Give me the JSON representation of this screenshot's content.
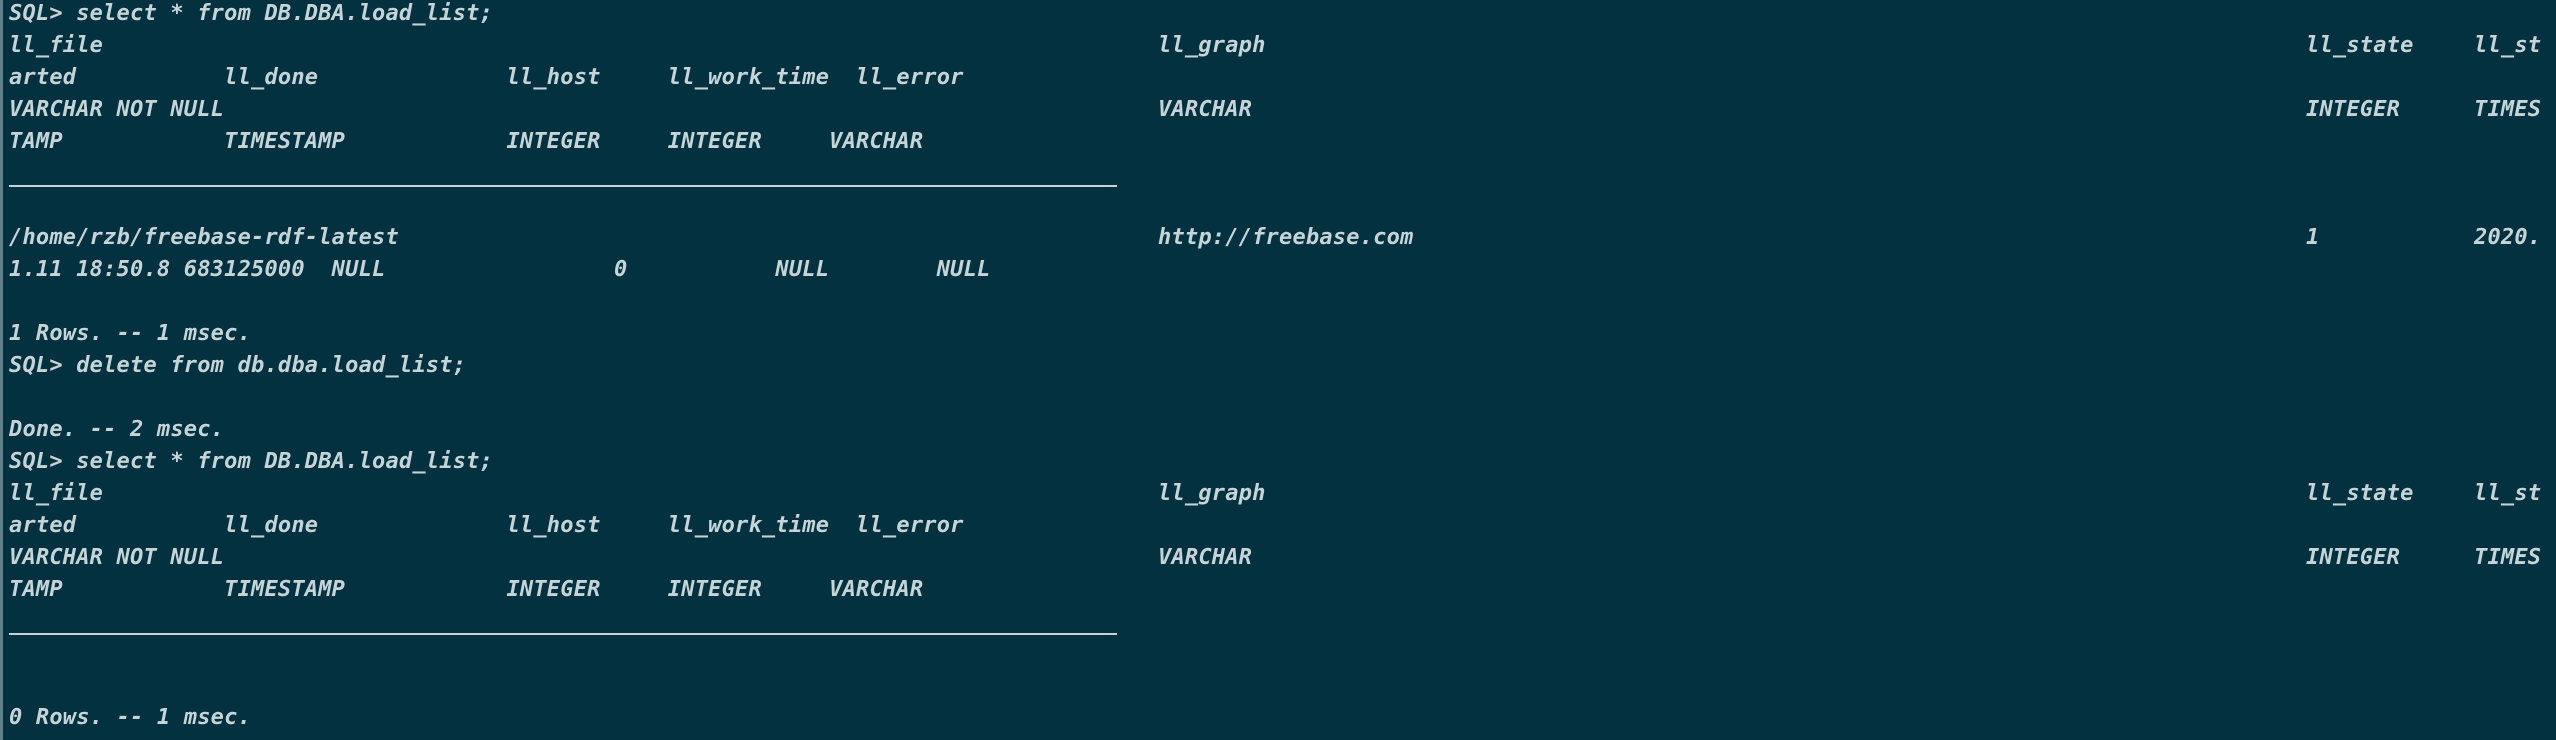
{
  "terminal": {
    "background": "#04313f",
    "text_color": "#c5d4d8",
    "cmd1": "SQL> select * from DB.DBA.load_list;",
    "h1_ll_file": "ll_file",
    "h1_ll_graph": "ll_graph",
    "h1_ll_state": "ll_state",
    "h1_ll_st": "ll_st",
    "h1_row2": "arted           ll_done              ll_host     ll_work_time  ll_error",
    "h1_type1": "VARCHAR NOT NULL",
    "h1_type_graph": "VARCHAR",
    "h1_type_state": "INTEGER",
    "h1_type_times": "TIMES",
    "h1_type2": "TAMP            TIMESTAMP            INTEGER     INTEGER     VARCHAR",
    "row_file": "/home/rzb/freebase-rdf-latest",
    "row_graph": "http://freebase.com",
    "row_state": "1",
    "row_started": "2020.",
    "row_line2": "1.11 18:50.8 683125000  NULL                 0           NULL        NULL",
    "rows1": "1 Rows. -- 1 msec.",
    "cmd2": "SQL> delete from db.dba.load_list;",
    "done": "Done. -- 2 msec.",
    "cmd3": "SQL> select * from DB.DBA.load_list;",
    "h2_ll_file": "ll_file",
    "h2_ll_graph": "ll_graph",
    "h2_ll_state": "ll_state",
    "h2_ll_st": "ll_st",
    "h2_row2": "arted           ll_done              ll_host     ll_work_time  ll_error",
    "h2_type1": "VARCHAR NOT NULL",
    "h2_type_graph": "VARCHAR",
    "h2_type_state": "INTEGER",
    "h2_type_times": "TIMES",
    "h2_type2": "TAMP            TIMESTAMP            INTEGER     INTEGER     VARCHAR",
    "rows2": "0 Rows. -- 1 msec."
  }
}
